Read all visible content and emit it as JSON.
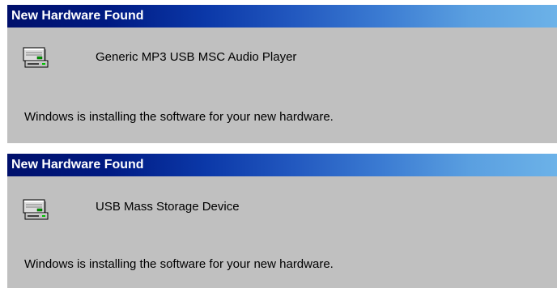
{
  "dialogs": [
    {
      "title": "New Hardware Found",
      "device_name": "Generic MP3 USB MSC Audio Player",
      "status": "Windows is installing the software for your new hardware.",
      "icon": "hardware-device-icon"
    },
    {
      "title": "New Hardware Found",
      "device_name": "USB Mass Storage Device",
      "status": "Windows is installing the software for your new hardware.",
      "icon": "hardware-device-icon"
    }
  ],
  "colors": {
    "titlebar_start": "#00106b",
    "titlebar_end": "#6cb2e8",
    "dialog_background": "#c0c0c0",
    "title_text": "#ffffff"
  }
}
